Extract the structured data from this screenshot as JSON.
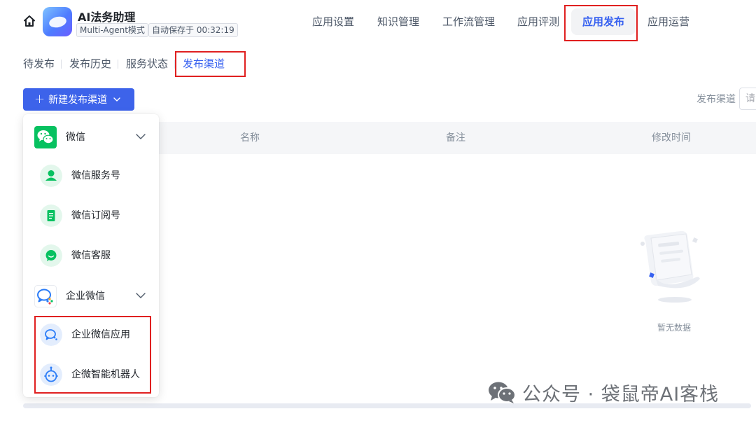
{
  "app": {
    "name": "AI法务助理",
    "mode_tag": "Multi-Agent模式",
    "autosave_tag": "自动保存于 00:32:19"
  },
  "top_nav": [
    {
      "label": "应用设置",
      "active": false
    },
    {
      "label": "知识管理",
      "active": false
    },
    {
      "label": "工作流管理",
      "active": false
    },
    {
      "label": "应用评测",
      "active": false
    },
    {
      "label": "应用发布",
      "active": true
    },
    {
      "label": "应用运营",
      "active": false
    }
  ],
  "sub_tabs": [
    {
      "label": "待发布",
      "active": false
    },
    {
      "label": "发布历史",
      "active": false
    },
    {
      "label": "服务状态",
      "active": false
    },
    {
      "label": "发布渠道",
      "active": true
    }
  ],
  "toolbar": {
    "new_channel_label": "新建发布渠道",
    "filter_label": "发布渠道",
    "filter_placeholder": "请"
  },
  "table": {
    "columns": [
      "名称",
      "备注",
      "修改时间"
    ],
    "empty_text": "暂无数据"
  },
  "dropdown": {
    "groups": [
      {
        "label": "微信",
        "icon": "wechat-icon",
        "items": [
          {
            "label": "微信服务号",
            "icon": "service-account-icon"
          },
          {
            "label": "微信订阅号",
            "icon": "subscription-account-icon"
          },
          {
            "label": "微信客服",
            "icon": "customer-service-icon"
          }
        ]
      },
      {
        "label": "企业微信",
        "icon": "wecom-icon",
        "items": [
          {
            "label": "企业微信应用",
            "icon": "wecom-app-icon"
          },
          {
            "label": "企微智能机器人",
            "icon": "robot-icon"
          }
        ]
      }
    ]
  },
  "watermark": {
    "text": "公众号 · 袋鼠帝AI客栈"
  },
  "colors": {
    "accent": "#3761f0",
    "button": "#3d63ea",
    "highlight_box": "#e02020",
    "wechat_green": "#07c160"
  }
}
